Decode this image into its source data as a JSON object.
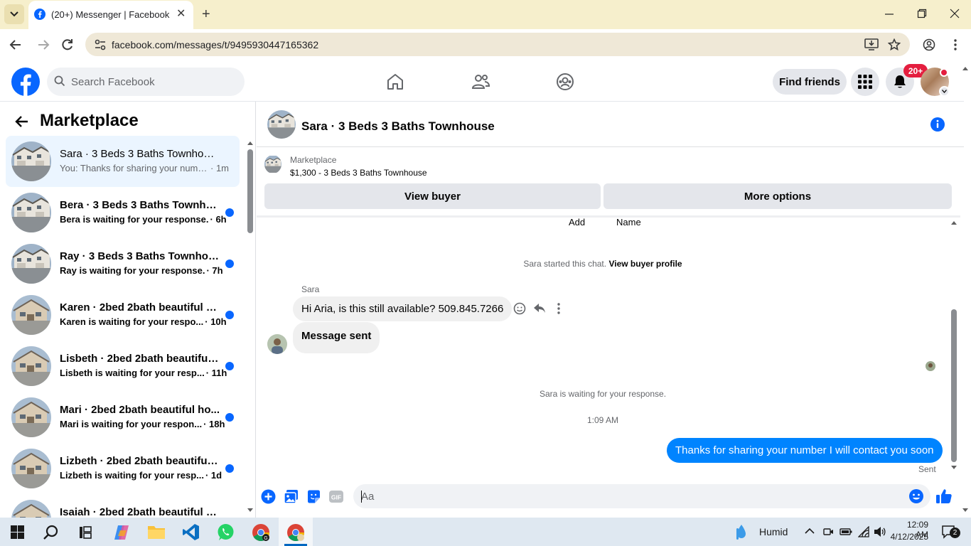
{
  "browser": {
    "tab_title": "(20+) Messenger | Facebook",
    "url": "facebook.com/messages/t/9495930447165362"
  },
  "fb": {
    "search_placeholder": "Search Facebook",
    "find_friends": "Find friends",
    "notif_badge": "20+"
  },
  "sidebar": {
    "title": "Marketplace",
    "chats": [
      {
        "name": "Sara · 3 Beds 3 Baths Townhouse",
        "preview": "You: Thanks for sharing your numb...",
        "time": "· 1m",
        "unread": false,
        "active": true
      },
      {
        "name": "Bera · 3 Beds 3 Baths Townhou...",
        "preview": "Bera is waiting for your response.",
        "time": "· 6h",
        "unread": true,
        "active": false
      },
      {
        "name": "Ray · 3 Beds 3 Baths Townhouse",
        "preview": "Ray is waiting for your response.",
        "time": "· 7h",
        "unread": true,
        "active": false
      },
      {
        "name": "Karen · 2bed 2bath beautiful h...",
        "preview": "Karen is waiting for your respo...",
        "time": "· 10h",
        "unread": true,
        "active": false
      },
      {
        "name": "Lisbeth · 2bed 2bath beautiful ...",
        "preview": "Lisbeth is waiting for your resp...",
        "time": "· 11h",
        "unread": true,
        "active": false
      },
      {
        "name": "Mari · 2bed 2bath beautiful ho...",
        "preview": "Mari is waiting for your respon...",
        "time": "· 18h",
        "unread": true,
        "active": false
      },
      {
        "name": "Lizbeth · 2bed 2bath beautiful ...",
        "preview": "Lizbeth is waiting for your resp...",
        "time": "· 1d",
        "unread": true,
        "active": false
      },
      {
        "name": "Isaiah · 2bed 2bath beautiful ho...",
        "preview": "",
        "time": "",
        "unread": true,
        "active": false
      }
    ]
  },
  "conversation": {
    "title": "Sara · 3 Beds 3 Baths Townhouse",
    "listing_source": "Marketplace",
    "listing_title": "$1,300 - 3 Beds 3 Baths Townhouse",
    "view_buyer": "View buyer",
    "more_options": "More options",
    "label_add": "Add",
    "label_name": "Name",
    "started_text": "Sara started this chat.",
    "started_link": "View buyer profile",
    "sender": "Sara",
    "msg1": "Hi Aria, is this still available? 509.845.7266",
    "msg2": "Message sent",
    "waiting": "Sara is waiting for your response.",
    "timestamp": "1:09 AM",
    "msg_out": "Thanks for sharing your number I will contact you soon",
    "sent_status": "Sent",
    "composer_placeholder": "Aa"
  },
  "taskbar": {
    "weather": "Humid",
    "time": "12:09 AM",
    "date": "4/12/2025",
    "notif_count": "2"
  },
  "colors": {
    "fb_blue": "#0866ff",
    "bubble_out": "#0084ff",
    "badge_red": "#e41e3f"
  },
  "icons": [
    "home-icon",
    "friends-icon",
    "groups-icon",
    "menu-grid-icon",
    "bell-icon",
    "info-icon",
    "like-icon",
    "emoji-icon",
    "gif-icon",
    "sticker-icon",
    "photo-icon",
    "plus-icon"
  ]
}
